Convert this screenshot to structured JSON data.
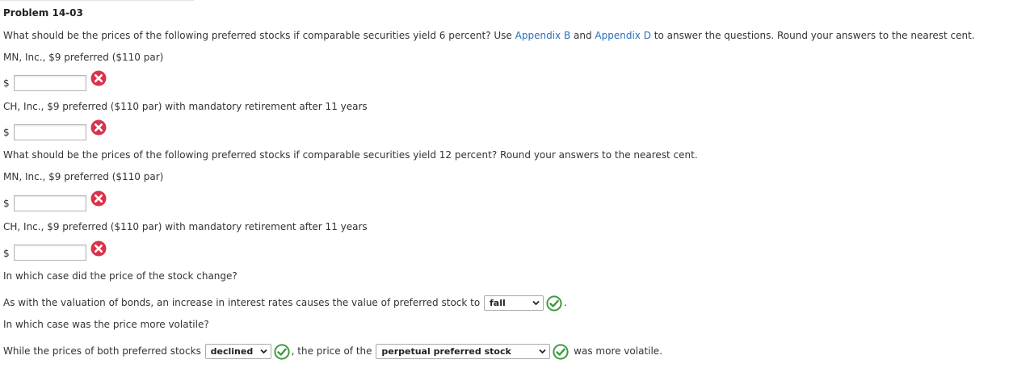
{
  "problem": {
    "title": "Problem 14-03"
  },
  "part1": {
    "q_before": "What should be the prices of the following preferred stocks if comparable securities yield 6 percent? Use ",
    "link_b": "Appendix B",
    "q_mid": " and ",
    "link_d": "Appendix D",
    "q_after": " to answer the questions. Round your answers to the nearest cent.",
    "mn_label": "MN, Inc., $9 preferred ($110 par)",
    "mn_value": "",
    "ch_label": "CH, Inc., $9 preferred ($110 par) with mandatory retirement after 11 years",
    "ch_value": ""
  },
  "part2": {
    "question": "What should be the prices of the following preferred stocks if comparable securities yield 12 percent? Round your answers to the nearest cent.",
    "mn_label": "MN, Inc., $9 preferred ($110 par)",
    "mn_value": "",
    "ch_label": "CH, Inc., $9 preferred ($110 par) with mandatory retirement after 11 years",
    "ch_value": ""
  },
  "currency_symbol": "$",
  "part3": {
    "question1": "In which case did the price of the stock change?",
    "s1_before": "As with the valuation of bonds, an increase in interest rates causes the value of preferred stock to ",
    "s1_select": "fall",
    "s1_after": ".",
    "question2": "In which case was the price more volatile?",
    "s2_before": "While the prices of both preferred stocks ",
    "s2_select1": "declined",
    "s2_mid": ", the price of the ",
    "s2_select2": "perpetual preferred stock",
    "s2_after": " was more volatile."
  },
  "colors": {
    "link": "#2a6ebb",
    "wrong": "#d9334b",
    "correct": "#3d9a3d"
  },
  "icons": {
    "wrong": "x-circle-icon",
    "correct": "check-circle-icon",
    "dropdown": "chevron-down-icon"
  }
}
